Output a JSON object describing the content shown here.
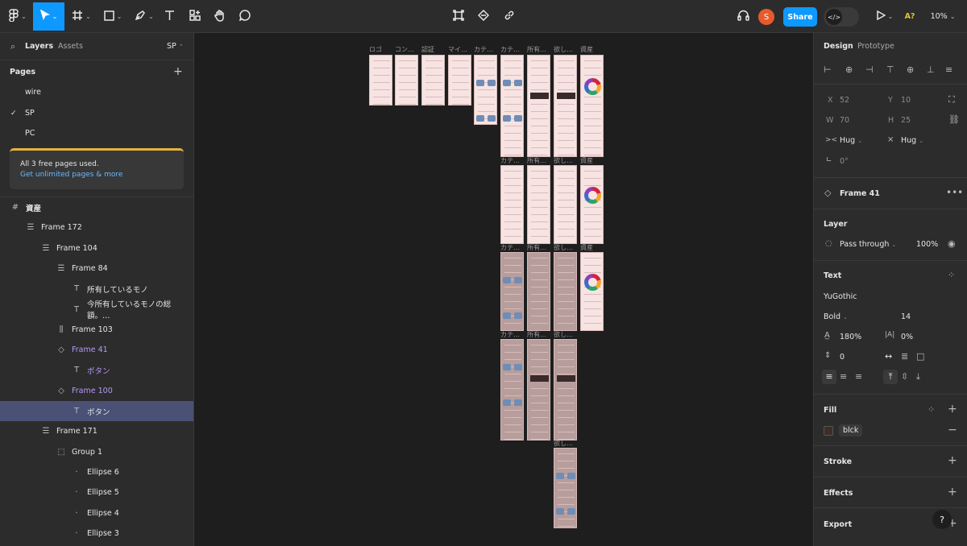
{
  "toolbar": {
    "share_label": "Share",
    "user_initial": "S",
    "ai_label": "A?",
    "zoom": "10%"
  },
  "left_panel": {
    "tabs": {
      "layers": "Layers",
      "assets": "Assets",
      "page_switch": "SP"
    },
    "pages_title": "Pages",
    "pages": [
      "wire",
      "SP",
      "PC"
    ],
    "banner": {
      "title": "All 3 free pages used.",
      "link": "Get unlimited pages & more"
    },
    "layers": [
      {
        "label": "資産",
        "indent": 0,
        "icon": "frame-hash-icon"
      },
      {
        "label": "Frame 172",
        "indent": 1,
        "icon": "autolayout-vertical-icon"
      },
      {
        "label": "Frame 104",
        "indent": 2,
        "icon": "autolayout-vertical-icon"
      },
      {
        "label": "Frame 84",
        "indent": 3,
        "icon": "autolayout-vertical-icon"
      },
      {
        "label": "所有しているモノ",
        "indent": 4,
        "icon": "text-icon"
      },
      {
        "label": "今所有しているモノの総額。…",
        "indent": 4,
        "icon": "text-icon"
      },
      {
        "label": "Frame 103",
        "indent": 3,
        "icon": "autolayout-horizontal-icon"
      },
      {
        "label": "Frame 41",
        "indent": 3,
        "icon": "component-instance-icon"
      },
      {
        "label": "ボタン",
        "indent": 4,
        "icon": "text-icon"
      },
      {
        "label": "Frame 100",
        "indent": 3,
        "icon": "component-instance-icon"
      },
      {
        "label": "ボタン",
        "indent": 4,
        "icon": "text-icon"
      },
      {
        "label": "Frame 171",
        "indent": 2,
        "icon": "autolayout-vertical-icon"
      },
      {
        "label": "Group 1",
        "indent": 3,
        "icon": "group-icon"
      },
      {
        "label": "Ellipse 6",
        "indent": 4,
        "icon": "ellipse-icon"
      },
      {
        "label": "Ellipse 5",
        "indent": 4,
        "icon": "ellipse-icon"
      },
      {
        "label": "Ellipse 4",
        "indent": 4,
        "icon": "ellipse-icon"
      },
      {
        "label": "Ellipse 3",
        "indent": 4,
        "icon": "ellipse-icon"
      }
    ]
  },
  "right_panel": {
    "tabs": {
      "design": "Design",
      "prototype": "Prototype"
    },
    "x_label": "X",
    "x": "52",
    "y_label": "Y",
    "y": "10",
    "w_label": "W",
    "w": "70",
    "h_label": "H",
    "h": "25",
    "hug_w": "Hug",
    "hug_h": "Hug",
    "rotation": "0°",
    "component_name": "Frame 41",
    "layer_title": "Layer",
    "blend": "Pass through",
    "opacity": "100%",
    "text_title": "Text",
    "font_family": "YuGothic",
    "font_weight": "Bold",
    "font_size": "14",
    "line_height": "180%",
    "letter_spacing": "0%",
    "paragraph_spacing": "0",
    "fill_title": "Fill",
    "fill_style": "blck",
    "fill_color": "#3b2e2a",
    "stroke_title": "Stroke",
    "effects_title": "Effects",
    "export_title": "Export",
    "help": "?"
  },
  "canvas": {
    "frame_labels": [
      "ロゴ",
      "コン…",
      "認証",
      "マイ…",
      "カテ…",
      "カテ…",
      "所有…",
      "欲し…",
      "資産",
      "カテ…",
      "所有…",
      "欲し…",
      "資産",
      "カテ…",
      "所有…",
      "欲し…",
      "資産",
      "カテ…",
      "所有…",
      "欲し…",
      "欲し…"
    ]
  }
}
